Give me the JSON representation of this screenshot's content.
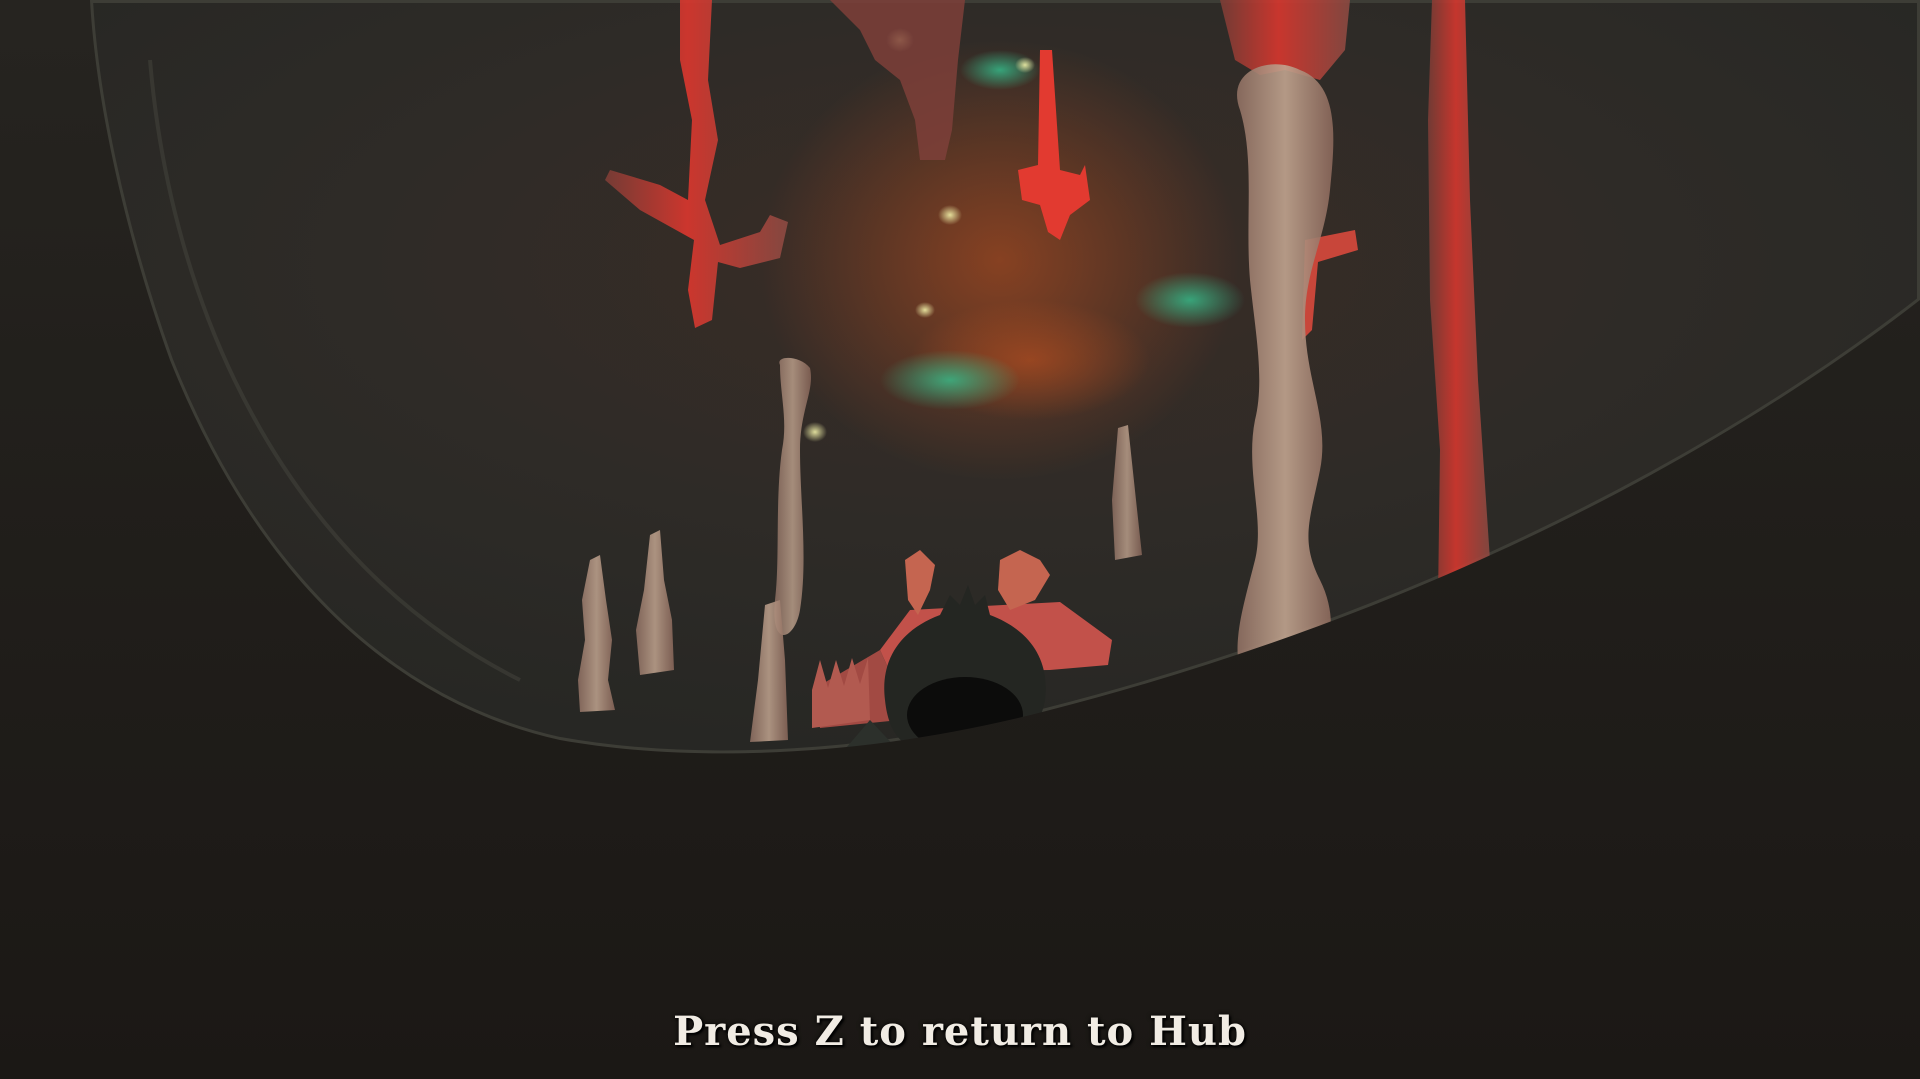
{
  "hud": {
    "prompt": "Press Z to return to Hub"
  },
  "scene": {
    "description_colors": {
      "background": "#1e1a17",
      "glass_dome": "#2c2c27",
      "coral_red": "#d9372e",
      "coral_stone": "#b89a88",
      "glow_teal": "#2fa37c",
      "glow_orange": "#b5441f"
    },
    "icons": [
      "creature-silhouette-icon"
    ]
  }
}
